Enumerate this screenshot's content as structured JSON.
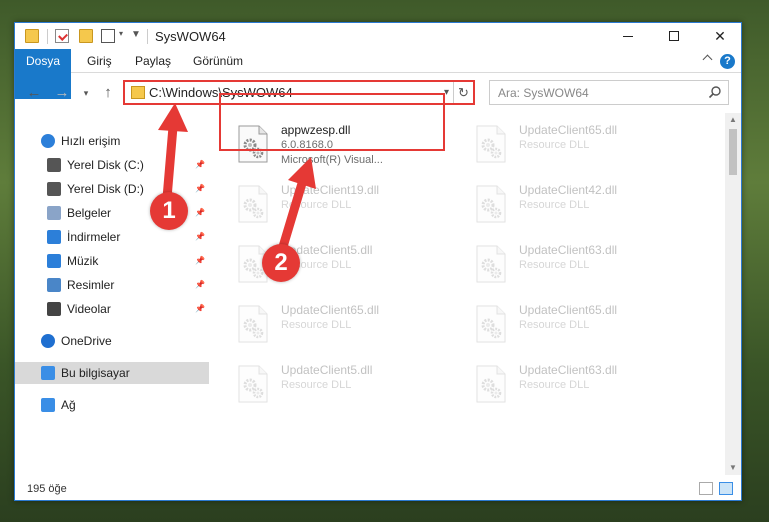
{
  "window": {
    "title": "SysWOW64",
    "tabs": [
      "Dosya",
      "Giriş",
      "Paylaş",
      "Görünüm"
    ],
    "help": "?"
  },
  "address": {
    "path": "C:\\Windows\\SysWOW64",
    "search_placeholder": "Ara: SysWOW64"
  },
  "sidebar": {
    "items": [
      {
        "label": "Hızlı erişim",
        "icon": "star-icon",
        "pinned": false
      },
      {
        "label": "Yerel Disk (C:)",
        "icon": "drive-icon",
        "pinned": true
      },
      {
        "label": "Yerel Disk (D:)",
        "icon": "drive-icon",
        "pinned": true
      },
      {
        "label": "Belgeler",
        "icon": "documents-icon",
        "pinned": true
      },
      {
        "label": "İndirmeler",
        "icon": "downloads-icon",
        "pinned": true
      },
      {
        "label": "Müzik",
        "icon": "music-icon",
        "pinned": true
      },
      {
        "label": "Resimler",
        "icon": "pictures-icon",
        "pinned": true
      },
      {
        "label": "Videolar",
        "icon": "videos-icon",
        "pinned": true
      },
      {
        "label": "OneDrive",
        "icon": "cloud-icon",
        "pinned": false
      },
      {
        "label": "Bu bilgisayar",
        "icon": "computer-icon",
        "pinned": false,
        "selected": true
      },
      {
        "label": "Ağ",
        "icon": "network-icon",
        "pinned": false
      }
    ]
  },
  "files": {
    "highlighted": {
      "name": "appwzesp.dll",
      "version": "6.0.8168.0",
      "company": "Microsoft(R) Visual..."
    },
    "ghosts": [
      {
        "name": "UpdateClient65.dll",
        "desc": "Resource DLL"
      },
      {
        "name": "UpdateClient19.dll",
        "desc": "Resource DLL"
      },
      {
        "name": "UpdateClient42.dll",
        "desc": "Resource DLL"
      },
      {
        "name": "UpdateClient5.dll",
        "desc": "Resource DLL"
      },
      {
        "name": "UpdateClient63.dll",
        "desc": "Resource DLL"
      },
      {
        "name": "UpdateClient65.dll",
        "desc": "Resource DLL"
      },
      {
        "name": "UpdateClient65.dll",
        "desc": "Resource DLL"
      },
      {
        "name": "UpdateClient5.dll",
        "desc": "Resource DLL"
      },
      {
        "name": "UpdateClient63.dll",
        "desc": "Resource DLL"
      }
    ]
  },
  "status": {
    "count": "195 öğe"
  },
  "annotations": {
    "badge1": "1",
    "badge2": "2",
    "color": "#e53935"
  }
}
